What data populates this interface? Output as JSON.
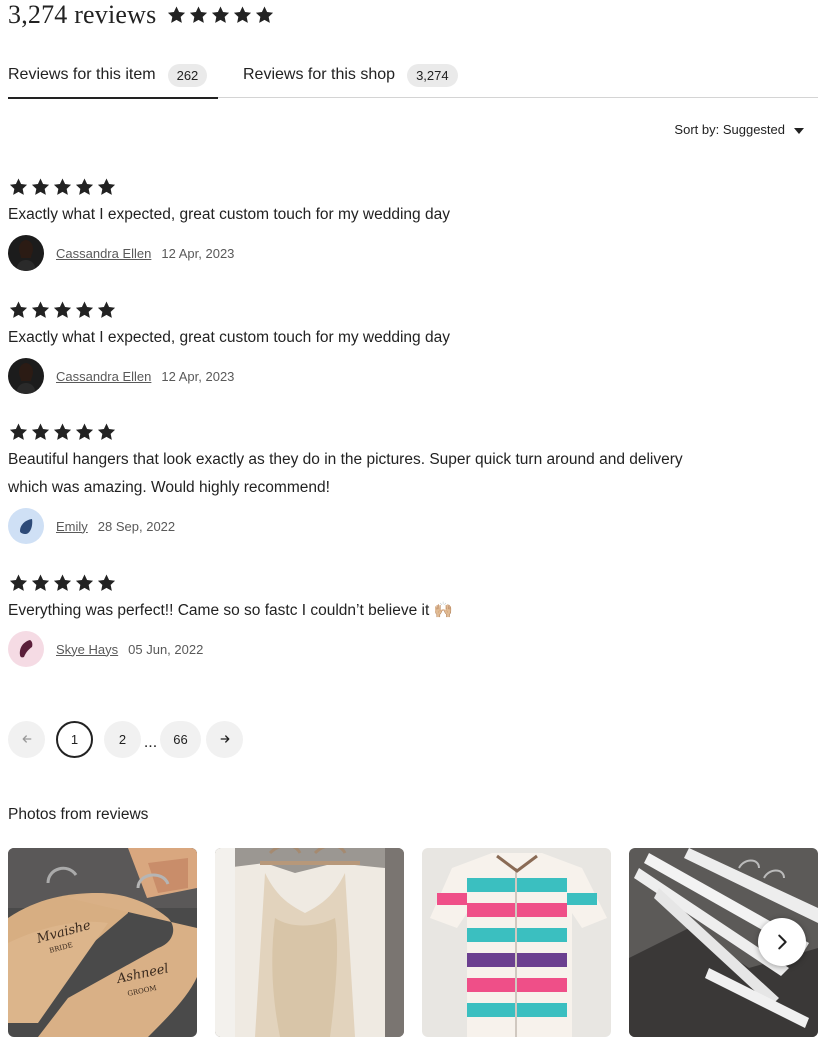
{
  "header": {
    "title": "3,274 reviews",
    "rating_stars": 5
  },
  "tabs": [
    {
      "label": "Reviews for this item",
      "count": "262",
      "active": true
    },
    {
      "label": "Reviews for this shop",
      "count": "3,274",
      "active": false
    }
  ],
  "sort": {
    "label": "Sort by: Suggested",
    "icon": "caret-down-icon"
  },
  "reviews": [
    {
      "stars": 5,
      "text": "Exactly what I expected, great custom touch for my wedding day",
      "author": "Cassandra Ellen",
      "date": "12 Apr, 2023"
    },
    {
      "stars": 5,
      "text": "Exactly what I expected, great custom touch for my wedding day",
      "author": "Cassandra Ellen",
      "date": "12 Apr, 2023"
    },
    {
      "stars": 5,
      "text": "Beautiful hangers that look exactly as they do in the pictures. Super quick turn around and delivery which was amazing. Would highly recommend!",
      "author": "Emily",
      "date": "28 Sep, 2022"
    },
    {
      "stars": 5,
      "text": "Everything was perfect!! Came so so fastc I couldn’t believe it 🙌🏼",
      "author": "Skye Hays",
      "date": "05 Jun, 2022"
    }
  ],
  "pagination": {
    "pages": [
      "1",
      "2",
      "66"
    ],
    "current": "1",
    "ellipsis": "...",
    "prev_icon": "arrow-left-icon",
    "next_icon": "arrow-right-icon"
  },
  "photos": {
    "title": "Photos from reviews",
    "items": [
      "hangers-photo",
      "dress-photo",
      "shirt-photo",
      "white-hangers-photo"
    ],
    "next_icon": "chevron-right-icon"
  },
  "colors": {
    "text": "#222222",
    "muted": "#595959",
    "chip": "#eaeaea",
    "border": "#d4d4d4"
  }
}
